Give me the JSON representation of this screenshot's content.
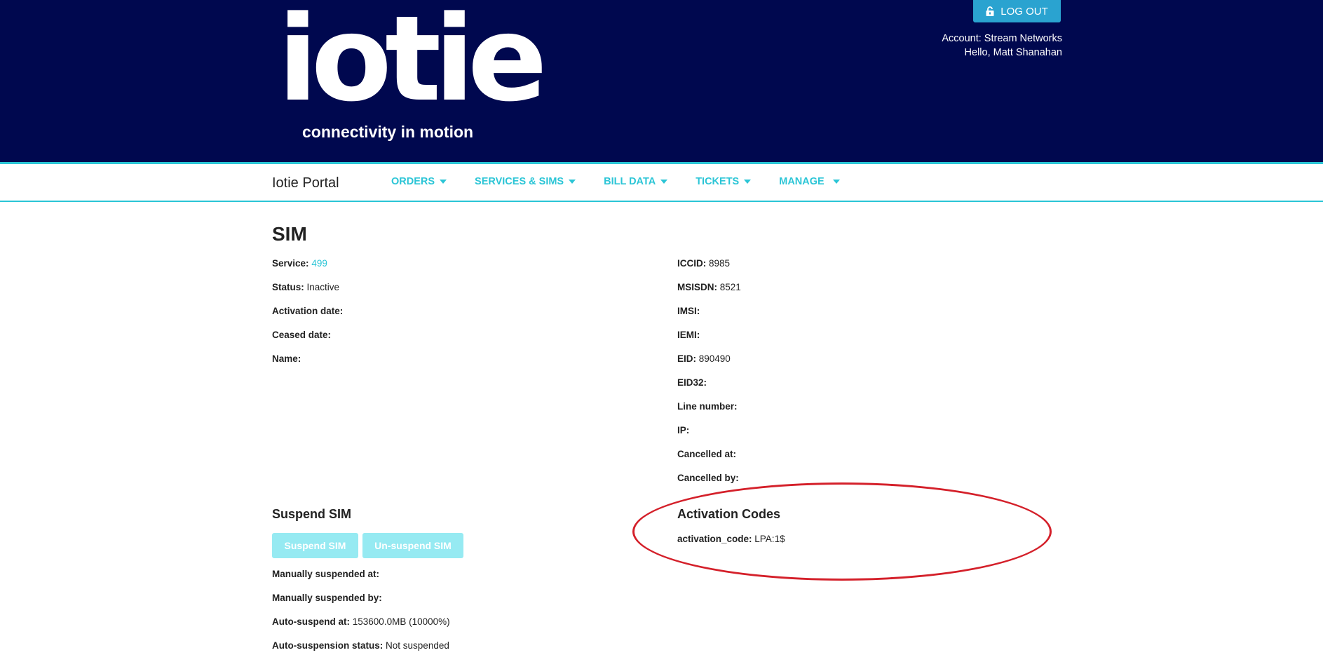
{
  "header": {
    "logo_text": "iotie",
    "tagline": "connectivity in motion",
    "logout_label": "LOG OUT",
    "account_line": "Account: Stream Networks",
    "greeting_line": "Hello, Matt Shanahan"
  },
  "nav": {
    "portal_title": "Iotie Portal",
    "items": [
      {
        "label": "ORDERS"
      },
      {
        "label": "SERVICES & SIMS"
      },
      {
        "label": "BILL DATA"
      },
      {
        "label": "TICKETS"
      },
      {
        "label": "MANAGE"
      }
    ]
  },
  "sim": {
    "title": "SIM",
    "left": [
      {
        "label": "Service:",
        "value": "499"
      },
      {
        "label": "Status:",
        "value": "Inactive"
      },
      {
        "label": "Activation date:",
        "value": ""
      },
      {
        "label": "Ceased date:",
        "value": ""
      },
      {
        "label": "Name:",
        "value": ""
      }
    ],
    "right": [
      {
        "label": "ICCID:",
        "value": "8985"
      },
      {
        "label": "MSISDN:",
        "value": "8521"
      },
      {
        "label": "IMSI:",
        "value": ""
      },
      {
        "label": "IEMI:",
        "value": ""
      },
      {
        "label": "EID:",
        "value": "890490"
      },
      {
        "label": "EID32:",
        "value": ""
      },
      {
        "label": "Line number:",
        "value": ""
      },
      {
        "label": "IP:",
        "value": ""
      },
      {
        "label": "Cancelled at:",
        "value": ""
      },
      {
        "label": "Cancelled by:",
        "value": ""
      }
    ]
  },
  "suspend": {
    "title": "Suspend SIM",
    "suspend_label": "Suspend SIM",
    "unsuspend_label": "Un-suspend SIM",
    "fields": [
      {
        "label": "Manually suspended at:",
        "value": ""
      },
      {
        "label": "Manually suspended by:",
        "value": ""
      },
      {
        "label": "Auto-suspend at:",
        "value": "153600.0MB (10000%)"
      },
      {
        "label": "Auto-suspension status:",
        "value": "Not suspended"
      }
    ]
  },
  "activation": {
    "title": "Activation Codes",
    "label": "activation_code:",
    "value": "LPA:1$"
  },
  "colors": {
    "header_bg": "#00084f",
    "accent": "#2bc5d6",
    "logout_bg": "#2aa3d0",
    "disabled_button": "#96eaf2",
    "annotation": "#d4202a"
  }
}
